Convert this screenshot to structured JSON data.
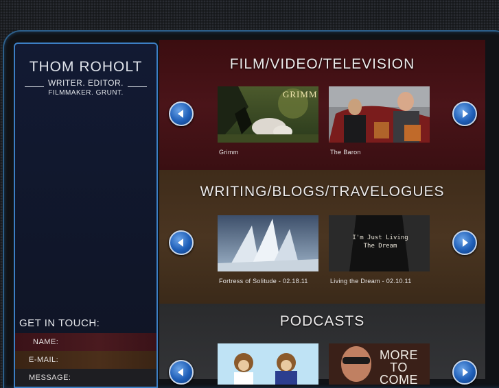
{
  "brand": {
    "name": "THOM ROHOLT",
    "tagline_line1": "WRITER. EDITOR.",
    "tagline_line2": "FILMMAKER. GRUNT."
  },
  "contact": {
    "heading": "GET IN TOUCH:",
    "name_label": "NAME:",
    "email_label": "E-MAIL:",
    "message_label": "MESSAGE:"
  },
  "sections": [
    {
      "title": "FILM/VIDEO/TELEVISION",
      "items": [
        {
          "caption": "Grimm",
          "overlay": "GRIMM"
        },
        {
          "caption": "The Baron"
        }
      ]
    },
    {
      "title": "WRITING/BLOGS/TRAVELOGUES",
      "items": [
        {
          "caption": "Fortress of Solitude - 02.18.11"
        },
        {
          "caption": "Living the Dream - 02.10.11",
          "overlay": "I'm Just Living The Dream"
        }
      ]
    },
    {
      "title": "PODCASTS",
      "items": [
        {
          "caption": ""
        },
        {
          "caption": "",
          "overlay": "MORE TO COME"
        }
      ]
    }
  ],
  "icons": {
    "prev": "chevron-left-icon",
    "next": "chevron-right-icon"
  },
  "colors": {
    "accent_blue": "#3c7fc4",
    "film_bg": "#4a1419",
    "writing_bg": "#4a3521",
    "podcasts_bg": "#333437"
  }
}
